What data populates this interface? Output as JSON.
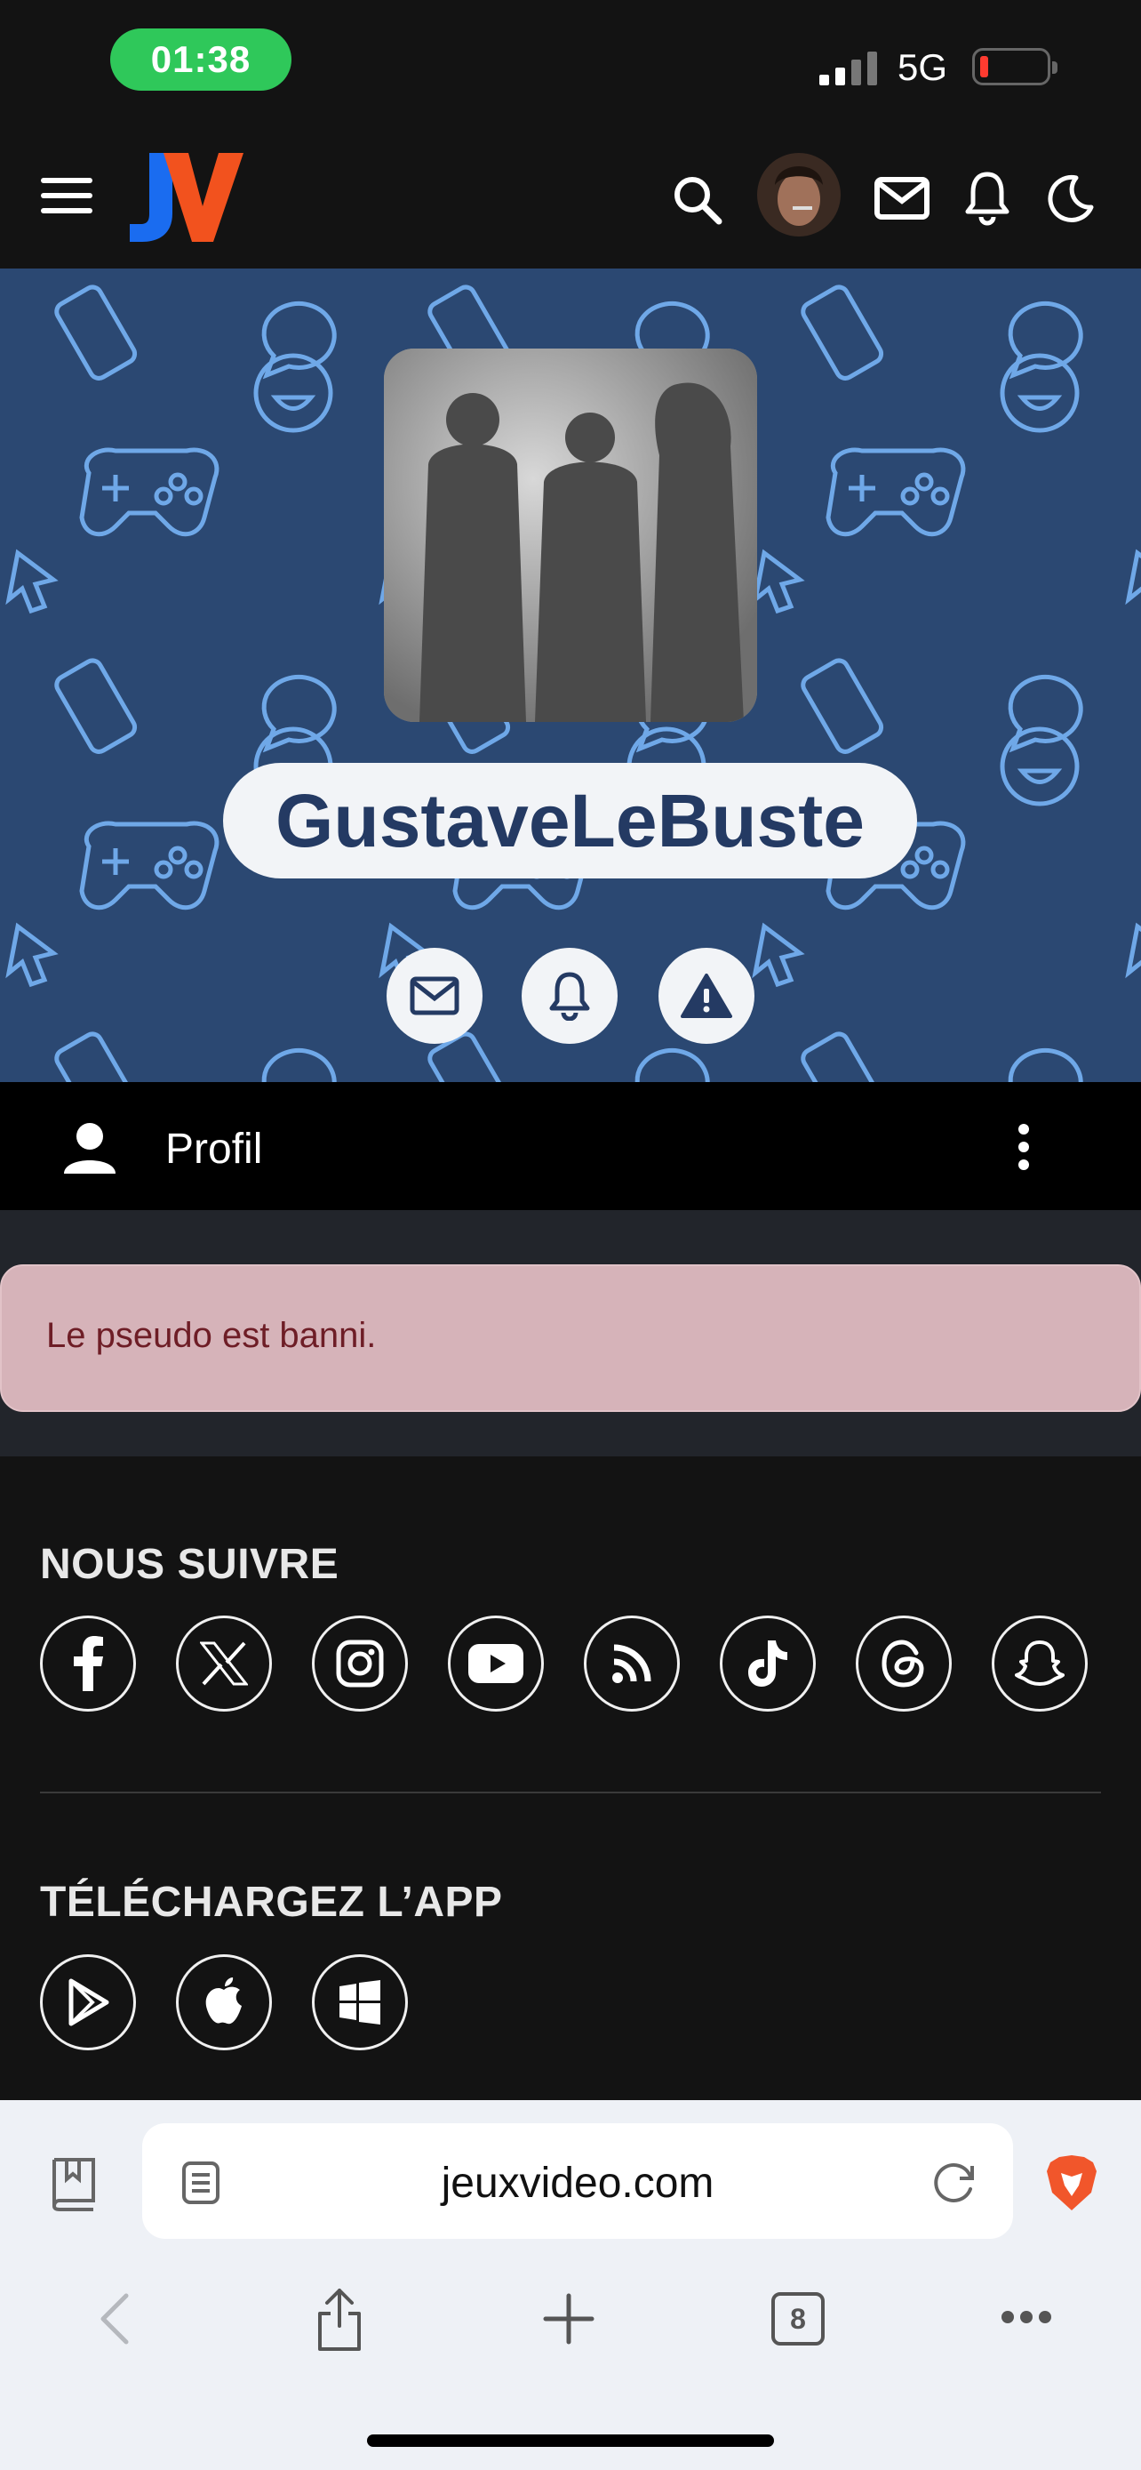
{
  "status_bar": {
    "time": "01:38",
    "network": "5G"
  },
  "header": {
    "menu_icon": "hamburger-icon",
    "logo_text": "JV",
    "icons": [
      "search-icon",
      "avatar",
      "mail-icon",
      "bell-icon",
      "moon-icon"
    ]
  },
  "profile": {
    "username": "GustaveLeBuste",
    "actions": [
      "mail-icon",
      "bell-icon",
      "warning-icon"
    ]
  },
  "profile_tab": {
    "label": "Profil"
  },
  "alert": {
    "message": "Le pseudo est banni."
  },
  "footer": {
    "follow_title": "NOUS SUIVRE",
    "socials": [
      "facebook-icon",
      "x-icon",
      "instagram-icon",
      "youtube-icon",
      "rss-icon",
      "tiktok-icon",
      "threads-icon",
      "snapchat-icon"
    ],
    "app_title": "TÉLÉCHARGEZ L’APP",
    "apps": [
      "google-play-icon",
      "apple-icon",
      "windows-icon"
    ]
  },
  "browser": {
    "url": "jeuxvideo.com",
    "tab_count": "8"
  },
  "colors": {
    "banner": "#2b4872",
    "alert_bg": "#d6b3b9",
    "alert_text": "#6e1d26",
    "status_pill": "#2fc85a",
    "name_text": "#243a63"
  }
}
